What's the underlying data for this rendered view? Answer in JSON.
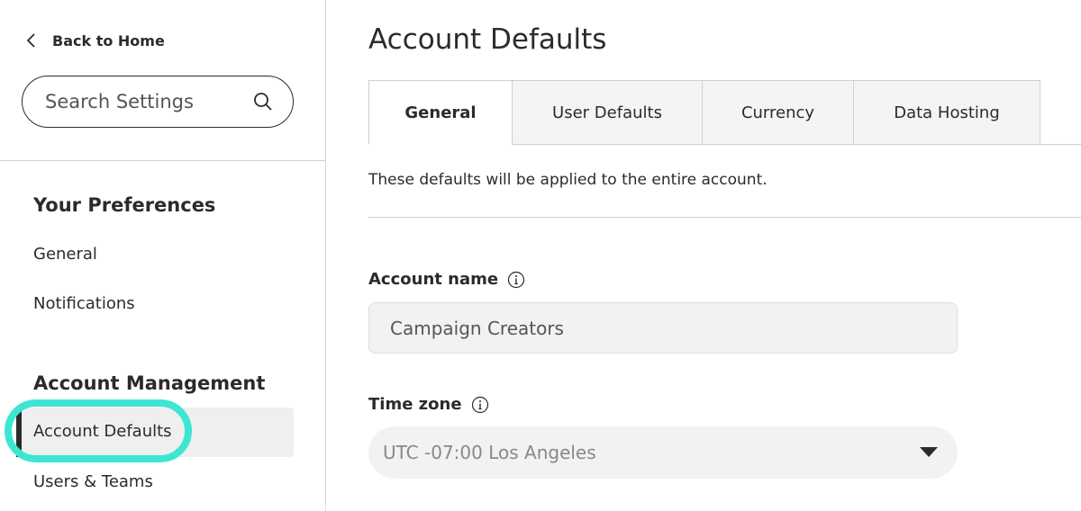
{
  "sidebar": {
    "back_label": "Back to Home",
    "search_placeholder": "Search Settings",
    "sections": [
      {
        "title": "Your Preferences",
        "items": [
          "General",
          "Notifications"
        ]
      },
      {
        "title": "Account Management",
        "items": [
          "Account Defaults",
          "Users & Teams"
        ],
        "active": "Account Defaults"
      }
    ]
  },
  "main": {
    "title": "Account Defaults",
    "tabs": [
      {
        "label": "General",
        "active": true
      },
      {
        "label": "User Defaults",
        "active": false
      },
      {
        "label": "Currency",
        "active": false
      },
      {
        "label": "Data Hosting",
        "active": false
      }
    ],
    "description": "These defaults will be applied to the entire account.",
    "fields": {
      "account_name": {
        "label": "Account name",
        "value": "Campaign Creators"
      },
      "time_zone": {
        "label": "Time zone",
        "value": "UTC -07:00 Los Angeles"
      }
    }
  },
  "colors": {
    "highlight": "#3de6d2",
    "text": "#2b2b2b",
    "active_bar": "#2b2b2b"
  }
}
